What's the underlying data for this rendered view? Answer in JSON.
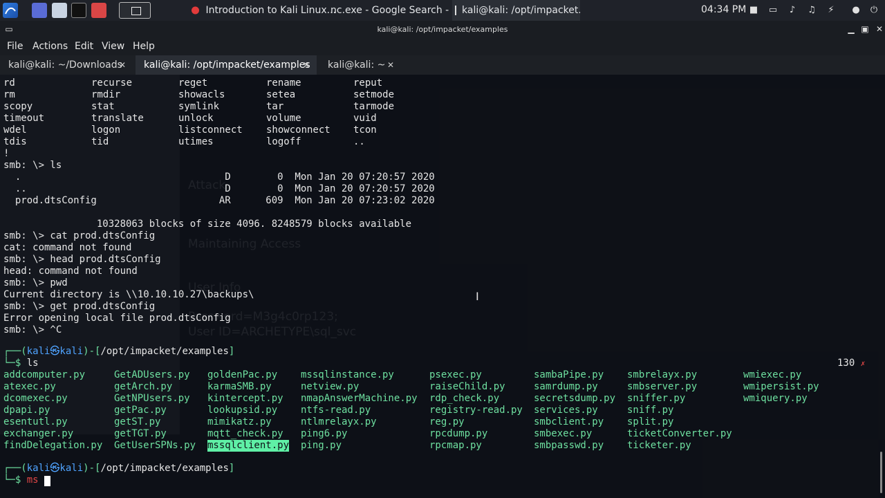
{
  "taskbar": {
    "tasks": [
      {
        "label": "Introduction to Kali Linux..."
      },
      {
        "label": "nc.exe - Google Search - ..."
      },
      {
        "label": "kali@kali: /opt/impacket..."
      }
    ],
    "clock": "04:34 PM"
  },
  "window": {
    "title": "kali@kali: /opt/impacket/examples",
    "menu": [
      "File",
      "Actions",
      "Edit",
      "View",
      "Help"
    ],
    "tabs": [
      {
        "label": "kali@kali: ~/Downloads"
      },
      {
        "label": "kali@kali: /opt/impacket/examples"
      },
      {
        "label": "kali@kali: ~"
      }
    ]
  },
  "terminal": {
    "help_rows": [
      [
        "rd",
        "recurse",
        "reget",
        "rename",
        "reput"
      ],
      [
        "rm",
        "rmdir",
        "showacls",
        "setea",
        "setmode"
      ],
      [
        "scopy",
        "stat",
        "symlink",
        "tar",
        "tarmode"
      ],
      [
        "timeout",
        "translate",
        "unlock",
        "volume",
        "vuid"
      ],
      [
        "wdel",
        "logon",
        "listconnect",
        "showconnect",
        "tcon"
      ],
      [
        "tdis",
        "tid",
        "utimes",
        "logoff",
        ".."
      ]
    ],
    "lines": [
      "!",
      "smb: \\> ls",
      "  .                                   D        0  Mon Jan 20 07:20:57 2020",
      "  ..                                  D        0  Mon Jan 20 07:20:57 2020",
      "  prod.dtsConfig                     AR      609  Mon Jan 20 07:23:02 2020",
      "",
      "                10328063 blocks of size 4096. 8248579 blocks available",
      "smb: \\> cat prod.dtsConfig",
      "cat: command not found",
      "smb: \\> head prod.dtsConfig",
      "head: command not found",
      "smb: \\> pwd",
      "Current directory is \\\\10.10.10.27\\backups\\",
      "smb: \\> get prod.dtsConfig",
      "Error opening local file prod.dtsConfig",
      "smb: \\> ^C"
    ],
    "prompt": {
      "open": "┌──(",
      "user": "kali㉿kali",
      "sep": ")-[",
      "path": "/opt/impacket/examples",
      "close": "]",
      "corner": "└─$"
    },
    "ls_command": "ls",
    "exit_code": "130",
    "exit_mark": "✗",
    "ls_columns": [
      [
        "addcomputer.py",
        "atexec.py",
        "dcomexec.py",
        "dpapi.py",
        "esentutl.py",
        "exchanger.py",
        "findDelegation.py"
      ],
      [
        "GetADUsers.py",
        "getArch.py",
        "GetNPUsers.py",
        "getPac.py",
        "getST.py",
        "getTGT.py",
        "GetUserSPNs.py"
      ],
      [
        "goldenPac.py",
        "karmaSMB.py",
        "kintercept.py",
        "lookupsid.py",
        "mimikatz.py",
        "mqtt_check.py",
        "mssqlclient.py"
      ],
      [
        "mssqlinstance.py",
        "netview.py",
        "nmapAnswerMachine.py",
        "ntfs-read.py",
        "ntlmrelayx.py",
        "ping6.py",
        "ping.py"
      ],
      [
        "psexec.py",
        "raiseChild.py",
        "rdp_check.py",
        "registry-read.py",
        "reg.py",
        "rpcdump.py",
        "rpcmap.py"
      ],
      [
        "sambaPipe.py",
        "samrdump.py",
        "secretsdump.py",
        "services.py",
        "smbclient.py",
        "smbexec.py",
        "smbpasswd.py"
      ],
      [
        "smbrelayx.py",
        "smbserver.py",
        "sniffer.py",
        "sniff.py",
        "split.py",
        "ticketConverter.py",
        "ticketer.py"
      ],
      [
        "wmiexec.py",
        "wmipersist.py",
        "wmiquery.py"
      ]
    ],
    "current_input": "ms",
    "background_ghost": [
      "Attack",
      "Maintaining Access",
      "User Info",
      "Password=M3g4c0rp123;",
      "User ID=ARCHETYPE\\sql_svc"
    ]
  }
}
